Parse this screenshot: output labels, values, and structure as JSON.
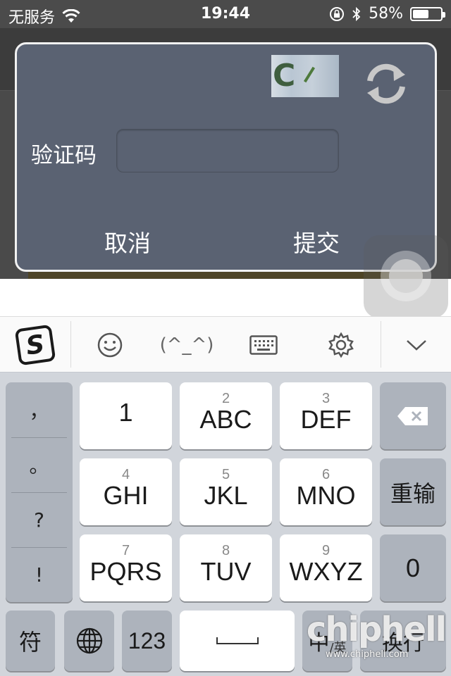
{
  "status_bar": {
    "carrier": "无服务",
    "time": "19:44",
    "battery_percent": "58%",
    "battery_level": 0.58
  },
  "dialog": {
    "captcha_text": "C",
    "label": "验证码",
    "input_value": "",
    "cancel_label": "取消",
    "submit_label": "提交"
  },
  "keyboard_toolbar": {
    "emoticon": "(^_^)",
    "icons": [
      "sogou-logo-icon",
      "emoji-icon",
      "keyboard-icon",
      "settings-gear-icon",
      "chevron-down-icon"
    ]
  },
  "keyboard": {
    "punctuation": [
      "，",
      "。",
      "?",
      "!"
    ],
    "keys": [
      {
        "digit": "",
        "letters": "1"
      },
      {
        "digit": "2",
        "letters": "ABC"
      },
      {
        "digit": "3",
        "letters": "DEF"
      },
      {
        "digit": "4",
        "letters": "GHI"
      },
      {
        "digit": "5",
        "letters": "JKL"
      },
      {
        "digit": "6",
        "letters": "MNO"
      },
      {
        "digit": "7",
        "letters": "PQRS"
      },
      {
        "digit": "8",
        "letters": "TUV"
      },
      {
        "digit": "9",
        "letters": "WXYZ"
      }
    ],
    "retype": "重输",
    "zero": "0",
    "symbol": "符",
    "num_mode": "123",
    "lang_main": "中",
    "lang_sub": "/英",
    "newline": "换行"
  },
  "watermark": {
    "brand": "chiphell",
    "url": "www.chiphell.com"
  },
  "colors": {
    "dialog_bg": "#5a6272",
    "keyboard_bg": "#d1d5db",
    "status_bar_bg": "#4b4b4b"
  }
}
